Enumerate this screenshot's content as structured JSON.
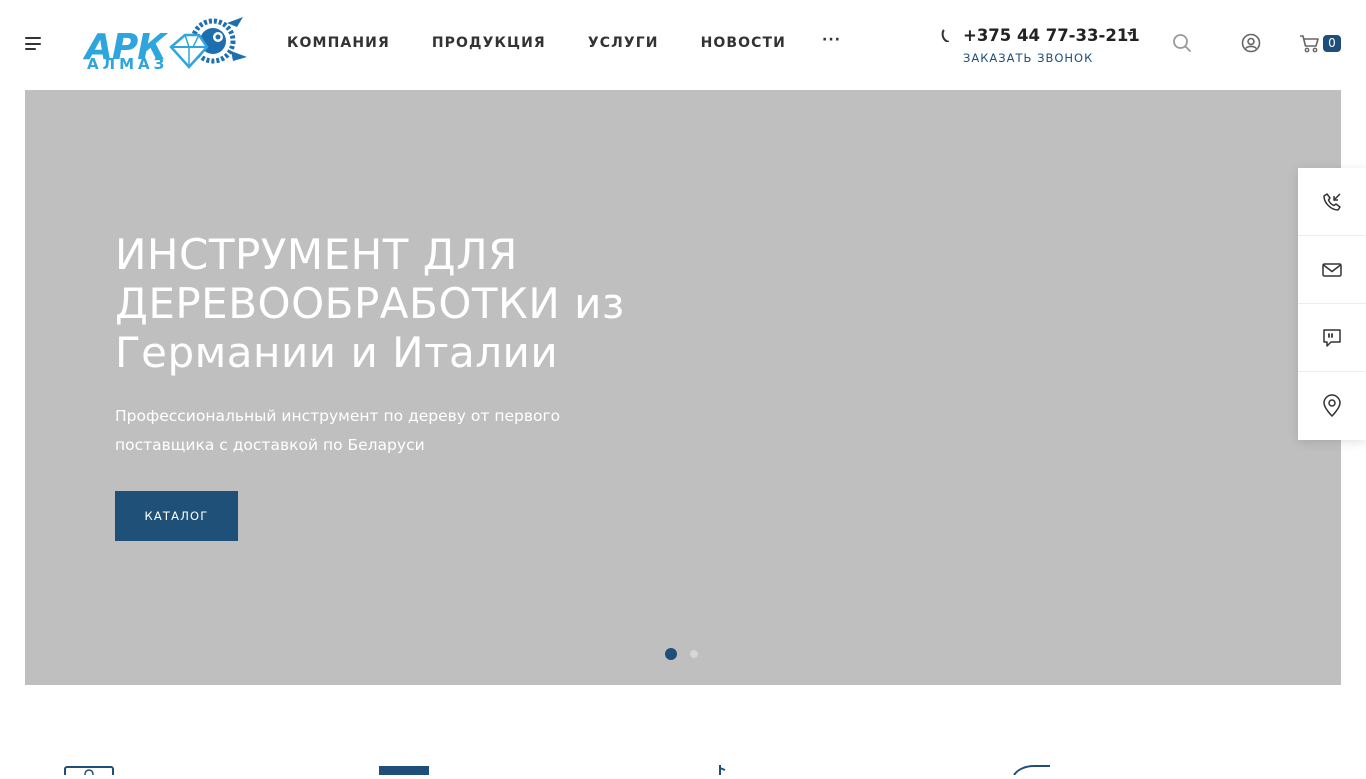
{
  "logo": {
    "main": "АРК",
    "sub": "АЛМАЗ"
  },
  "nav": {
    "items": [
      "КОМПАНИЯ",
      "ПРОДУКЦИЯ",
      "УСЛУГИ",
      "НОВОСТИ"
    ],
    "more": "···"
  },
  "contacts": {
    "phone": "+375 44 77-33-211",
    "callback": "ЗАКАЗАТЬ ЗВОНОК"
  },
  "cart": {
    "count": "0"
  },
  "hero": {
    "title": "ИНСТРУМЕНТ ДЛЯ ДЕРЕВООБРАБОТКИ из Германии и Италии",
    "subtitle": "Профессиональный инструмент по дереву от первого поставщика с доставкой по Беларуси",
    "button": "КАТАЛОГ",
    "slides_total": 2,
    "active_slide": 1
  },
  "side_panel": {
    "items": [
      "phone-callback-icon",
      "mail-icon",
      "chat-icon",
      "location-pin-icon"
    ]
  },
  "colors": {
    "brand_blue": "#1f5078",
    "logo_cyan": "#2fa5dd",
    "hero_bg": "#bfbfbf"
  }
}
